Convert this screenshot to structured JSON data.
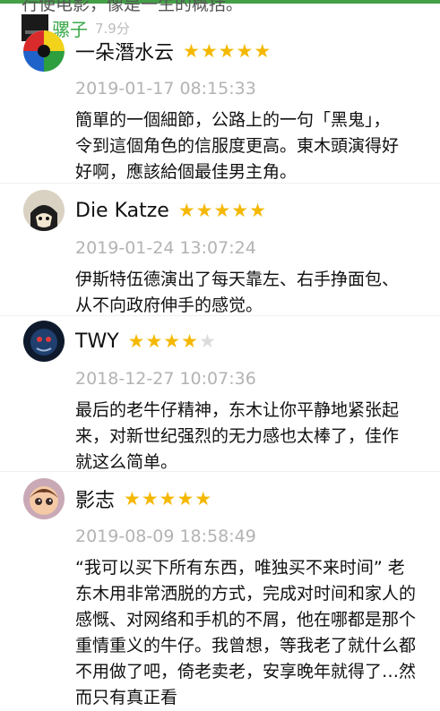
{
  "header": {
    "cut_text": "行使电影，像是一生的概括。",
    "movie_title": "骡子",
    "movie_score": "7.9分"
  },
  "colors": {
    "accent": "#43a047",
    "star": "#f5b800",
    "star_empty": "#dcdcdc"
  },
  "reviews": [
    {
      "name": "一朵潛水云",
      "rating": 5,
      "date": "2019-01-17 08:15:33",
      "text": "簡單的一個細節，公路上的一句「黑鬼」，令到這個角色的信服度更高。東木頭演得好好啊，應該給個最佳男主角。"
    },
    {
      "name": "Die Katze",
      "rating": 5,
      "date": "2019-01-24 13:07:24",
      "text": "伊斯特伍德演出了每天靠左、右手挣面包、从不向政府伸手的感觉。"
    },
    {
      "name": "TWY",
      "rating": 4,
      "date": "2018-12-27 10:07:36",
      "text": "最后的老牛仔精神，东木让你平静地紧张起来，对新世纪强烈的无力感也太棒了，佳作就这么简单。"
    },
    {
      "name": "影志",
      "rating": 5,
      "date": "2019-08-09 18:58:49",
      "text": "“我可以买下所有东西，唯独买不来时间” 老东木用非常洒脱的方式，完成对时间和家人的感慨、对网络和手机的不屑，他在哪都是那个重情重义的牛仔。我曾想，等我老了就什么都不用做了吧，倚老卖老，安享晚年就得了…然而只有真正看"
    }
  ]
}
